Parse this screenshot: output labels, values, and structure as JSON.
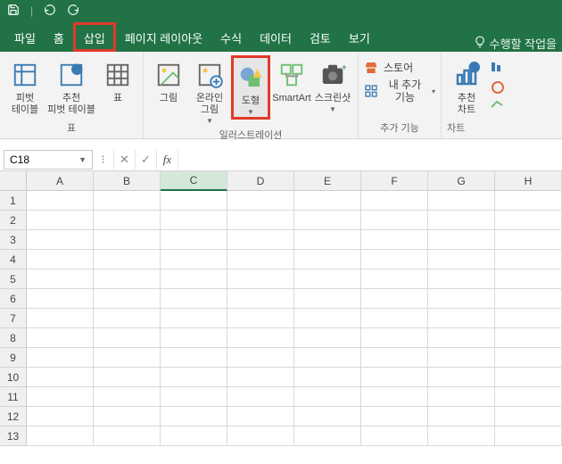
{
  "qat": {
    "save_icon": "save-icon",
    "undo_icon": "undo-icon",
    "redo_icon": "redo-icon"
  },
  "tabs": {
    "file": "파일",
    "home": "홈",
    "insert": "삽입",
    "pageLayout": "페이지 레이아웃",
    "formulas": "수식",
    "data": "데이터",
    "review": "검토",
    "view": "보기",
    "tellme": "수행할 작업을"
  },
  "ribbon": {
    "tables": {
      "pivot": "피벗\n테이블",
      "recPivot": "추천\n피벗 테이블",
      "table": "표",
      "label": "표"
    },
    "illust": {
      "picture": "그림",
      "onlinePicture": "온라인\n그림",
      "shapes": "도형",
      "smartart": "SmartArt",
      "screenshot": "스크린샷",
      "label": "일러스트레이션"
    },
    "addins": {
      "store": "스토어",
      "myaddins": "내 추가 기능",
      "label": "추가 기능"
    },
    "charts": {
      "recChart": "추천\n차트",
      "label": "차트"
    }
  },
  "namebox": {
    "value": "C18"
  },
  "grid": {
    "columns": [
      "A",
      "B",
      "C",
      "D",
      "E",
      "F",
      "G",
      "H"
    ],
    "rows": [
      "1",
      "2",
      "3",
      "4",
      "5",
      "6",
      "7",
      "8",
      "9",
      "10",
      "11",
      "12",
      "13"
    ],
    "selectedCol": "C"
  },
  "colors": {
    "brand": "#217346",
    "highlight": "#e03a2a"
  }
}
